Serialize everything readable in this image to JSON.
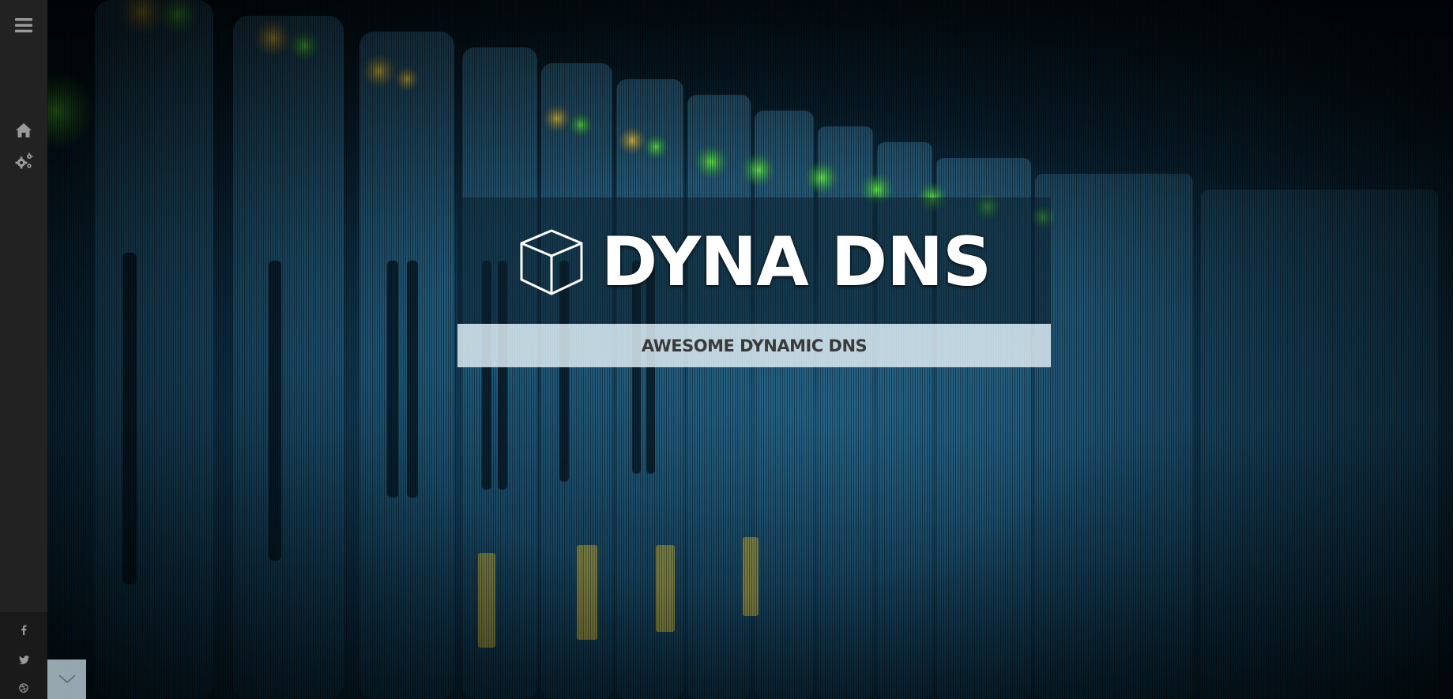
{
  "hero": {
    "title": "DYNA DNS",
    "tagline": "AWESOME DYNAMIC DNS",
    "logo_icon": "cube-icon"
  },
  "sidebar": {
    "menu_icon": "hamburger-menu-icon",
    "nav_items": [
      {
        "icon": "home-icon"
      },
      {
        "icon": "gears-icon"
      }
    ],
    "social": [
      {
        "icon": "facebook-icon"
      },
      {
        "icon": "twitter-icon"
      },
      {
        "icon": "dribbble-icon"
      }
    ]
  },
  "scroll": {
    "icon": "chevron-down-icon"
  },
  "colors": {
    "sidebar_bg": "#222222",
    "title_text": "#ffffff",
    "tagline_bg": "#dcebf2",
    "tagline_text": "#3a3a3a",
    "icon_color": "#9a9a9a"
  }
}
